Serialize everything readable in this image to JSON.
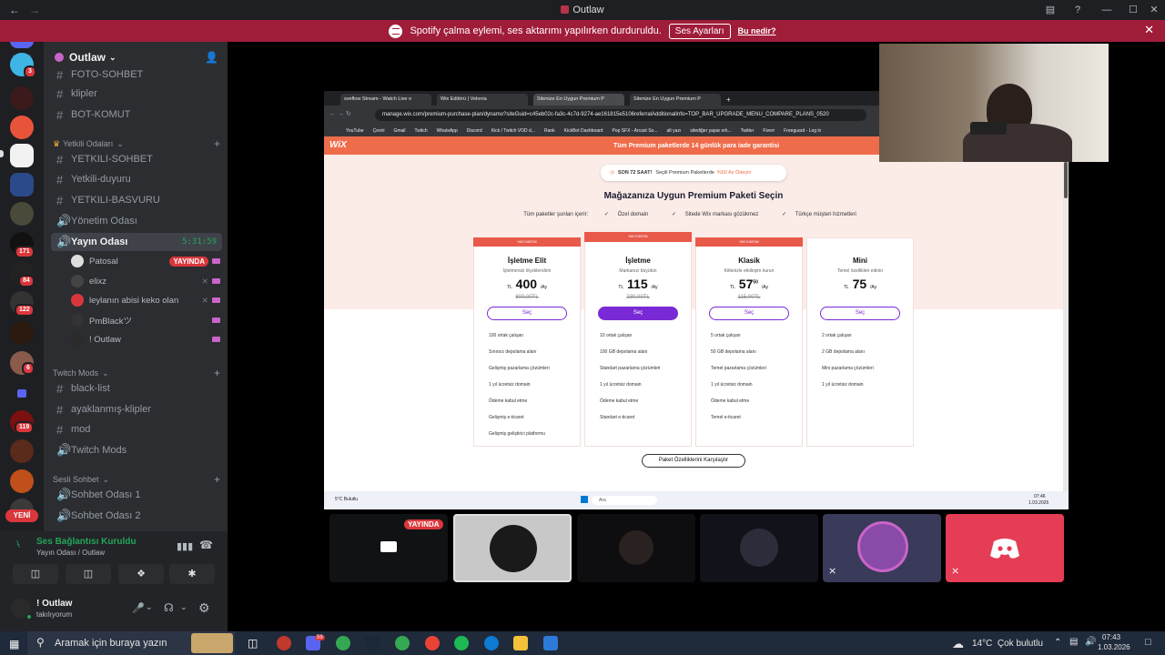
{
  "window": {
    "title": "Outlaw"
  },
  "banner": {
    "message": "Spotify çalma eylemi, ses aktarımı yapılırken durduruldu.",
    "button": "Ses Ayarları",
    "link": "Bu nedir?"
  },
  "rail": {
    "badges": [
      "3",
      "171",
      "84",
      "122",
      "6",
      "119"
    ],
    "new_label": "YENİ"
  },
  "sidebar": {
    "server_name": "Outlaw",
    "channels_top": [
      "FOTO-SOHBET",
      "klipler",
      "BOT-KOMUT"
    ],
    "cat_yetkili": "Yetkili Odaları",
    "channels_yetkili": [
      "YETKILI-SOHBET",
      "Yetkili-duyuru",
      "YETKILI-BASVURU",
      "Yönetim Odası"
    ],
    "voice_active": {
      "name": "Yayın Odası",
      "timer": "5:31:59"
    },
    "voice_users": [
      {
        "name": "Patosal",
        "live": "YAYINDA"
      },
      {
        "name": "elixz"
      },
      {
        "name": "leylanın abisi keko olan"
      },
      {
        "name": "PmBlackツ"
      },
      {
        "name": "! Outlaw"
      }
    ],
    "cat_twitch": "Twitch Mods",
    "channels_twitch": [
      "black-list",
      "ayaklanmış-klipler",
      "mod",
      "Twitch Mods"
    ],
    "cat_sesli": "Sesli Sohbet",
    "channels_sesli": [
      "Sohbet Odası 1",
      "Sohbet Odası 2"
    ]
  },
  "voice_panel": {
    "status": "Ses Bağlantısı Kuruldu",
    "location": "Yayın Odası / Outlaw"
  },
  "user_panel": {
    "name": "! Outlaw",
    "status": "takılıyorum"
  },
  "screen": {
    "tabs": [
      "sveflow Stream - Watch Live o",
      "Wix Editörü | Velonia",
      "Sitenize En Uygun Premium P",
      "Sitenize En Uygun Premium P"
    ],
    "url": "manage.wix.com/premium-purchase-plan/dynamo?siteGuid=c45eb02c-fa3c-4c7d-9274-ae161815e5106referralAdditionalInfo=TOP_BAR_UPGRADE_MENU_COMPARE_PLANS_0520",
    "bookmarks": [
      "YouTube",
      "Çeviri",
      "Gmail",
      "Twitch",
      "WhatsApp",
      "Discord",
      "Kick / Twitch VOD d...",
      "Rank",
      "KickBot Dashboard",
      "Pop SFX - Arcast So...",
      "alt yazı",
      "sitediğer yapar ork...",
      "Twitter",
      "Fiverr",
      "Freeguard - Log in"
    ],
    "wix_logo": "WiX",
    "promo": "Tüm Premium paketlerde 14 günlük para iade garantisi",
    "pill": {
      "prefix": "SON 72 SAAT!",
      "text": "Seçili Premium Paketlerde",
      "off": "%50 Az Ödeyin"
    },
    "headline": "Mağazanıza Uygun Premium Paketi Seçin",
    "features": [
      "Tüm paketler şunları içerir:",
      "Özel domain",
      "Sitede Wix markası gözükmez",
      "Türkçe müşteri hizmetleri"
    ],
    "plans": [
      {
        "ribbon": "%50 İNDİRİM",
        "name": "İşletme Elit",
        "sub": "İşletmenizi ölçeklendirin",
        "currency": "TL",
        "price": "400",
        "per": "/Ay",
        "old": "800,00TL",
        "button": "Seç",
        "features": [
          "100 ortak çalışan",
          "Sınırsız depolama alanı",
          "Gelişmiş pazarlama çözümleri",
          "1 yıl ücretsiz domain",
          "Ödeme kabul etme",
          "Gelişmiş e-ticaret",
          "Gelişmiş geliştirici platformu"
        ]
      },
      {
        "ribbon": "%50 İNDİRİM",
        "name": "İşletme",
        "sub": "Markanızı büyütün",
        "currency": "TL",
        "price": "115",
        "per": "/Ay",
        "old": "230,00TL",
        "button": "Seç",
        "features": [
          "10 ortak çalışan",
          "100 GB depolama alanı",
          "Standart pazarlama çözümleri",
          "1 yıl ücretsiz domain",
          "Ödeme kabul etme",
          "Standart e-ticaret"
        ]
      },
      {
        "ribbon": "%50 İNDİRİM",
        "name": "Klasik",
        "sub": "Kitlenizle etkileşim kurun",
        "currency": "TL",
        "price": "57",
        "cents": "50",
        "per": "/Ay",
        "old": "115,00TL",
        "button": "Seç",
        "features": [
          "5 ortak çalışan",
          "50 GB depolama alanı",
          "Temel pazarlama çözümleri",
          "1 yıl ücretsiz domain",
          "Ödeme kabul etme",
          "Temel e-ticaret"
        ]
      },
      {
        "ribbon": "",
        "name": "Mini",
        "sub": "Temel özellikleri edinin",
        "currency": "TL",
        "price": "75",
        "per": "/Ay",
        "old": "",
        "button": "Seç",
        "features": [
          "2 ortak çalışan",
          "2 GB depolama alanı",
          "Mini pazarlama çözümleri",
          "1 yıl ücretsiz domain"
        ]
      }
    ],
    "compare_button": "Paket Özelliklerini Karşılaştır",
    "inner_taskbar": {
      "weather": "5°C Bulutlu",
      "search": "Ara",
      "time": "07:46",
      "date": "1.03.2026"
    }
  },
  "tiles": {
    "live_label": "YAYINDA"
  },
  "taskbar": {
    "search": "Aramak için buraya yazın",
    "weather": "14°C  Çok bulutlu",
    "time": "07:43",
    "date": "1.03.2026",
    "discord_badge": "59"
  },
  "colors": {
    "accent": "#5865f2",
    "banner": "#a01d3a",
    "live": "#da373c",
    "wix_purple": "#7a29d6",
    "wix_orange": "#ef6c4b"
  }
}
